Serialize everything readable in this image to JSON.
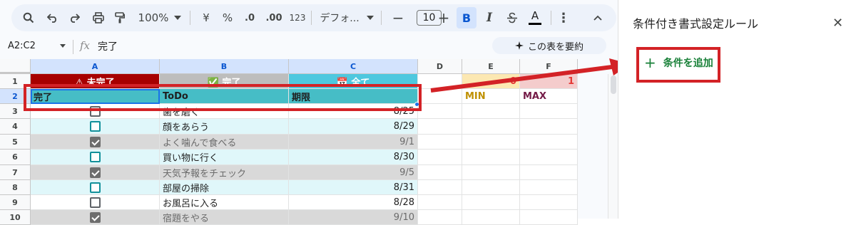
{
  "toolbar": {
    "zoom": "100%",
    "currency": "¥",
    "percent": "%",
    "decrease_decimal": ".0",
    "increase_decimal": ".00",
    "number_format": "123",
    "font_name": "デフォ...",
    "font_size": "10",
    "minus": "−",
    "plus": "+",
    "bold": "B",
    "italic": "I",
    "text_color": "A",
    "more": "⋮",
    "collapse": "^"
  },
  "formula_bar": {
    "name_box": "A2:C2",
    "fx": "fx",
    "content": "完了",
    "summarize_label": "この表を要約",
    "summarize_icon": "sparkle-icon"
  },
  "columns": [
    "A",
    "B",
    "C",
    "D",
    "E",
    "F"
  ],
  "rows": [
    "1",
    "2",
    "3",
    "4",
    "5",
    "6",
    "7",
    "8",
    "9",
    "10"
  ],
  "row1": {
    "a": "⚠ 未完了",
    "b": "✅ 完了",
    "c": "📅 全て",
    "e": "0",
    "f": "1"
  },
  "header_row": {
    "a": "完了",
    "b": "ToDo",
    "c": "期限",
    "e": "MIN",
    "f": "MAX"
  },
  "tasks": [
    {
      "checked": false,
      "todo": "歯を磨く",
      "due": "8/25"
    },
    {
      "checked": false,
      "todo": "顔をあらう",
      "due": "8/29"
    },
    {
      "checked": true,
      "todo": "よく噛んで食べる",
      "due": "9/1"
    },
    {
      "checked": false,
      "todo": "買い物に行く",
      "due": "8/30"
    },
    {
      "checked": true,
      "todo": "天気予報をチェック",
      "due": "9/5"
    },
    {
      "checked": false,
      "todo": "部屋の掃除",
      "due": "8/31"
    },
    {
      "checked": false,
      "todo": "お風呂に入る",
      "due": "8/28"
    },
    {
      "checked": true,
      "todo": "宿題をやる",
      "due": "9/10"
    }
  ],
  "colors": {
    "pending_header": "#a70000",
    "done_header": "#bdbdbd",
    "all_header": "#4ec8df",
    "header_row": "#46bdc6",
    "done_row": "#d9d9d9",
    "teal_row": "#e0f7fa",
    "annotation_red": "#d32226",
    "min_label": "#bf9000",
    "max_label": "#741b47"
  },
  "panel": {
    "title": "条件付き書式設定ルール",
    "close": "✕",
    "add_rule_plus": "+",
    "add_rule_label": "条件を追加"
  }
}
